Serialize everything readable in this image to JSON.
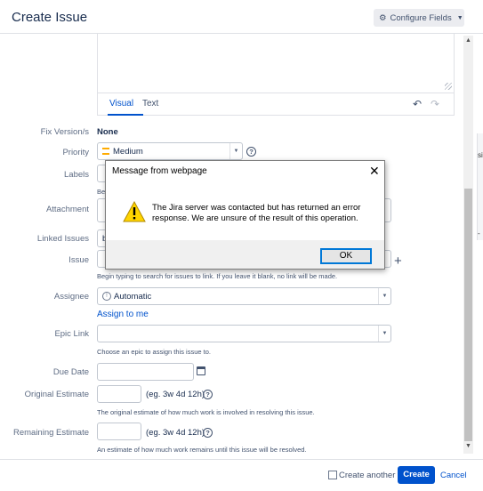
{
  "header": {
    "title": "Create Issue",
    "configure_fields": "Configure Fields"
  },
  "editor": {
    "tab_visual": "Visual",
    "tab_text": "Text"
  },
  "form": {
    "fix_version": {
      "label": "Fix Version/s",
      "value": "None"
    },
    "priority": {
      "label": "Priority",
      "value": "Medium"
    },
    "labels": {
      "label": "Labels",
      "hint": "Be"
    },
    "attachment": {
      "label": "Attachment"
    },
    "linked_issues": {
      "label": "Linked Issues",
      "value": "b"
    },
    "issue": {
      "label": "Issue",
      "hint": "Begin typing to search for issues to link. If you leave it blank, no link will be made."
    },
    "assignee": {
      "label": "Assignee",
      "value": "Automatic",
      "assign_to_me": "Assign to me"
    },
    "epic_link": {
      "label": "Epic Link",
      "value": "",
      "hint": "Choose an epic to assign this issue to."
    },
    "due_date": {
      "label": "Due Date",
      "value": ""
    },
    "original_estimate": {
      "label": "Original Estimate",
      "value": "",
      "example": "(eg. 3w 4d 12h)",
      "hint": "The original estimate of how much work is involved in resolving this issue."
    },
    "remaining_estimate": {
      "label": "Remaining Estimate",
      "value": "",
      "example": "(eg. 3w 4d 12h)",
      "hint": "An estimate of how much work remains until this issue will be resolved."
    }
  },
  "footer": {
    "create_another": "Create another",
    "create": "Create",
    "cancel": "Cancel"
  },
  "dialog": {
    "title": "Message from webpage",
    "close": "✕",
    "message": "The Jira server was contacted but has returned an error response. We are unsure of the result of this operation.",
    "ok": "OK"
  },
  "edge_letters": [
    "si",
    "-"
  ],
  "colors": {
    "primary": "#0052cc",
    "priority_medium": "#ffab00",
    "warning_yellow": "#ffd400"
  }
}
